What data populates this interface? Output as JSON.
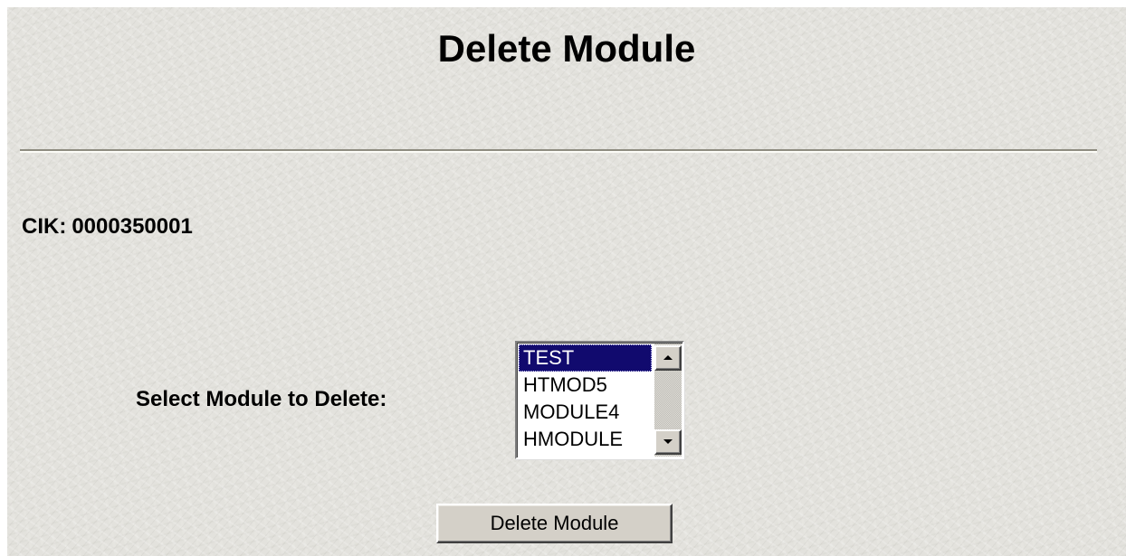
{
  "page": {
    "title": "Delete Module",
    "cik_label": "CIK:",
    "cik_value": "0000350001"
  },
  "form": {
    "select_label": "Select Module to Delete:",
    "modules": [
      "TEST",
      "HTMOD5",
      "MODULE4",
      "HMODULE"
    ],
    "selected_module": "TEST",
    "submit_label": "Delete Module"
  },
  "icons": {
    "scroll_up": "scroll-up-arrow-icon",
    "scroll_down": "scroll-down-arrow-icon"
  },
  "colors": {
    "selection_background": "#110a6e",
    "page_background": "#e3e2dd",
    "button_face": "#d4d0c8"
  }
}
